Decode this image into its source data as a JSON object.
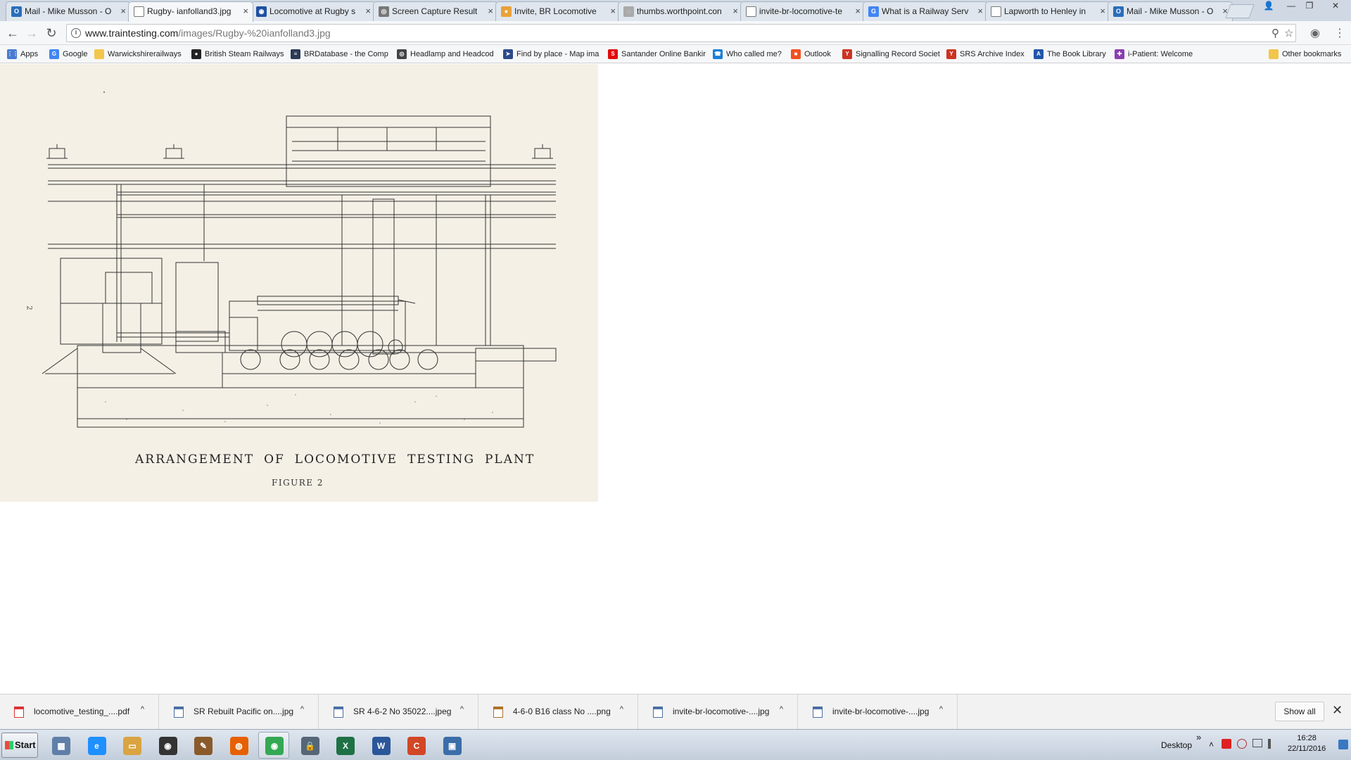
{
  "tabs": [
    {
      "label": "Mail - Mike Musson - O",
      "icon": "outlook-icon",
      "color": "#2a6ebb",
      "glyph": "O"
    },
    {
      "label": "Rugby- ianfolland3.jpg",
      "icon": "page-icon",
      "color": "#ffffff",
      "glyph": "",
      "active": true
    },
    {
      "label": "Locomotive at Rugby s",
      "icon": "site-icon",
      "color": "#1f4fa3",
      "glyph": "◉"
    },
    {
      "label": "Screen Capture Result",
      "icon": "camera-icon",
      "color": "#777777",
      "glyph": "◎"
    },
    {
      "label": "Invite, BR Locomotive",
      "icon": "globe-icon",
      "color": "#e8a23a",
      "glyph": "●"
    },
    {
      "label": "thumbs.worthpoint.con",
      "icon": "loading-icon",
      "color": "#aaaaaa",
      "glyph": "◌"
    },
    {
      "label": "invite-br-locomotive-te",
      "icon": "page-icon",
      "color": "#ffffff",
      "glyph": ""
    },
    {
      "label": "What is a Railway Serv",
      "icon": "google-icon",
      "color": "#4285f4",
      "glyph": "G"
    },
    {
      "label": "Lapworth to Henley in",
      "icon": "page-icon",
      "color": "#ffffff",
      "glyph": ""
    },
    {
      "label": "Mail - Mike Musson - O",
      "icon": "outlook-icon",
      "color": "#2a6ebb",
      "glyph": "O"
    }
  ],
  "toolbar": {
    "url_host": "www.traintesting.com",
    "url_path": "/images/Rugby-%20ianfolland3.jpg",
    "back": "←",
    "forward": "→",
    "reload": "↻",
    "zoom": "⚲",
    "star": "☆",
    "camera": "◉",
    "menu": "⋮",
    "info": "i"
  },
  "bookmarks": [
    {
      "label": "Apps",
      "icon": "apps-icon",
      "color": "#4a7bd1",
      "glyph": "⋮⋮"
    },
    {
      "label": "Google",
      "icon": "google-icon",
      "color": "#4285f4",
      "glyph": "G"
    },
    {
      "label": "Warwickshirerailways",
      "icon": "folder-icon",
      "color": "#f3c54b",
      "glyph": ""
    },
    {
      "label": "British Steam Railways",
      "icon": "circle-icon",
      "color": "#222222",
      "glyph": "●"
    },
    {
      "label": "BRDatabase - the Comp",
      "icon": "brd-icon",
      "color": "#2b3a55",
      "glyph": "≡"
    },
    {
      "label": "Headlamp and Headcod",
      "icon": "lamp-icon",
      "color": "#444444",
      "glyph": "◎"
    },
    {
      "label": "Find by place - Map ima",
      "icon": "pin-icon",
      "color": "#2c4a8a",
      "glyph": "➤"
    },
    {
      "label": "Santander Online Bankir",
      "icon": "santander-icon",
      "color": "#e10a0a",
      "glyph": "S"
    },
    {
      "label": "Who called me?",
      "icon": "phone-icon",
      "color": "#1a7ed6",
      "glyph": "☎"
    },
    {
      "label": "Outlook",
      "icon": "windows-icon",
      "color": "#f25022",
      "glyph": "■"
    },
    {
      "label": "Signalling Record Societ",
      "icon": "signal-icon",
      "color": "#cc3322",
      "glyph": "Y"
    },
    {
      "label": "SRS Archive Index",
      "icon": "signal-icon",
      "color": "#cc3322",
      "glyph": "Y"
    },
    {
      "label": "The Book Library",
      "icon": "book-icon",
      "color": "#2255aa",
      "glyph": "A"
    },
    {
      "label": "i-Patient: Welcome",
      "icon": "ipatient-icon",
      "color": "#8a3fb0",
      "glyph": "✚"
    },
    {
      "label": "Other bookmarks",
      "icon": "folder-icon",
      "color": "#f3c54b",
      "glyph": ""
    }
  ],
  "image": {
    "caption_words": [
      "ARRANGEMENT",
      "OF",
      "LOCOMOTIVE",
      "TESTING",
      "PLANT"
    ],
    "figure_label": "FIGURE 2",
    "page_mark": "2"
  },
  "downloads": [
    {
      "name": "locomotive_testing_....pdf",
      "icon": "pdf-icon",
      "color": "#d33"
    },
    {
      "name": "SR Rebuilt Pacific on....jpg",
      "icon": "image-file-icon",
      "color": "#4a6fa5"
    },
    {
      "name": "SR 4-6-2 No 35022....jpeg",
      "icon": "image-file-icon",
      "color": "#4a6fa5"
    },
    {
      "name": "4-6-0 B16 class No ....png",
      "icon": "image-file-icon",
      "color": "#b0702a"
    },
    {
      "name": "invite-br-locomotive-....jpg",
      "icon": "image-file-icon",
      "color": "#4a6fa5"
    },
    {
      "name": "invite-br-locomotive-....jpg",
      "icon": "image-file-icon",
      "color": "#4a6fa5"
    }
  ],
  "download_bar": {
    "show_all": "Show all",
    "close": "✕",
    "chevron": "^"
  },
  "taskbar": {
    "start": "Start",
    "apps": [
      {
        "icon": "calculator-icon",
        "color": "#5f7fa8",
        "glyph": "▦"
      },
      {
        "icon": "internet-explorer-icon",
        "color": "#1e90ff",
        "glyph": "e"
      },
      {
        "icon": "file-explorer-icon",
        "color": "#d9a441",
        "glyph": "▭"
      },
      {
        "icon": "eye-app-icon",
        "color": "#333333",
        "glyph": "◉"
      },
      {
        "icon": "gimp-icon",
        "color": "#8a5a2b",
        "glyph": "✎"
      },
      {
        "icon": "firefox-icon",
        "color": "#e66000",
        "glyph": "◍"
      },
      {
        "icon": "chrome-icon",
        "color": "#34a853",
        "glyph": "◉",
        "open": true
      },
      {
        "icon": "security-icon",
        "color": "#556677",
        "glyph": "🔒"
      },
      {
        "icon": "excel-icon",
        "color": "#1e7145",
        "glyph": "X"
      },
      {
        "icon": "word-icon",
        "color": "#2b579a",
        "glyph": "W"
      },
      {
        "icon": "ccleaner-icon",
        "color": "#d24726",
        "glyph": "C"
      },
      {
        "icon": "screen-capture-icon",
        "color": "#3b6ea8",
        "glyph": "▣"
      }
    ],
    "desktop_label": "Desktop",
    "desktop_chevron": "»",
    "tray_up": "˄",
    "time": "16:28",
    "date": "22/11/2016"
  },
  "window_controls": {
    "user": "👤",
    "minimize": "—",
    "restore": "❐",
    "close": "✕"
  }
}
